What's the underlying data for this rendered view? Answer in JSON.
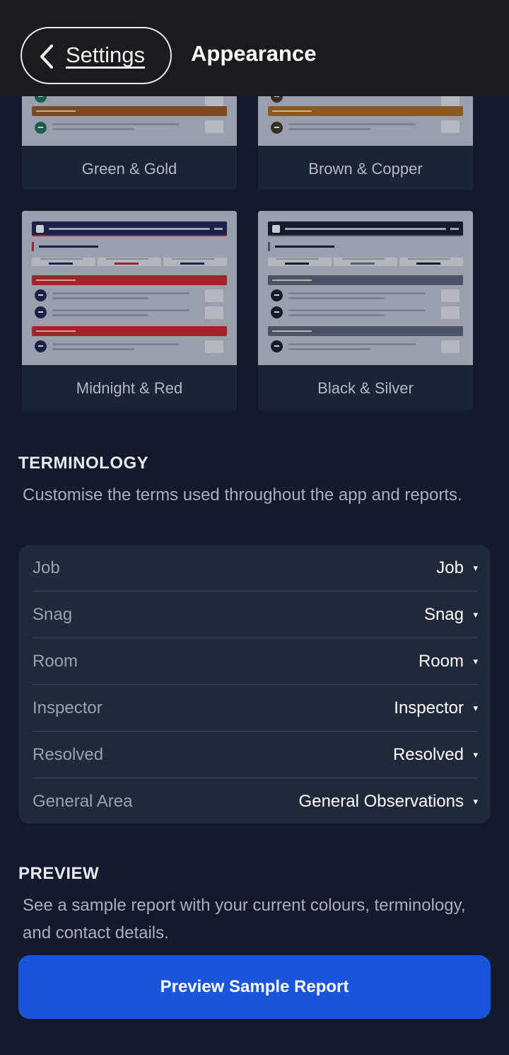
{
  "header": {
    "back_label": "Settings",
    "title": "Appearance"
  },
  "themes": [
    {
      "name": "Green & Gold",
      "accent": "#7c4a20",
      "dot": "#1e5d4c"
    },
    {
      "name": "Brown & Copper",
      "accent": "#8a5a22",
      "dot": "#3a2e2a"
    },
    {
      "name": "Midnight & Red",
      "header": "#1d2346",
      "accent": "#a3232b",
      "stat_colors": [
        "#1d2346",
        "#a3232b",
        "#1d2346"
      ],
      "dot": "#1d2346"
    },
    {
      "name": "Black & Silver",
      "header": "#151b27",
      "accent": "#4a5466",
      "stat_colors": [
        "#151b27",
        "#5a6372",
        "#151b27"
      ],
      "dot": "#151b27"
    }
  ],
  "terminology": {
    "heading": "TERMINOLOGY",
    "description": "Customise the terms used throughout the app and reports.",
    "rows": [
      {
        "label": "Job",
        "value": "Job"
      },
      {
        "label": "Snag",
        "value": "Snag"
      },
      {
        "label": "Room",
        "value": "Room"
      },
      {
        "label": "Inspector",
        "value": "Inspector"
      },
      {
        "label": "Resolved",
        "value": "Resolved"
      },
      {
        "label": "General Area",
        "value": "General Observations"
      }
    ],
    "caret": "▾"
  },
  "preview": {
    "heading": "PREVIEW",
    "description": "See a sample report with your current colours, terminology, and contact details.",
    "button_label": "Preview Sample Report"
  },
  "colors": {
    "background": "#121a2b",
    "card": "#1f2939",
    "primary_button": "#1a56db"
  }
}
